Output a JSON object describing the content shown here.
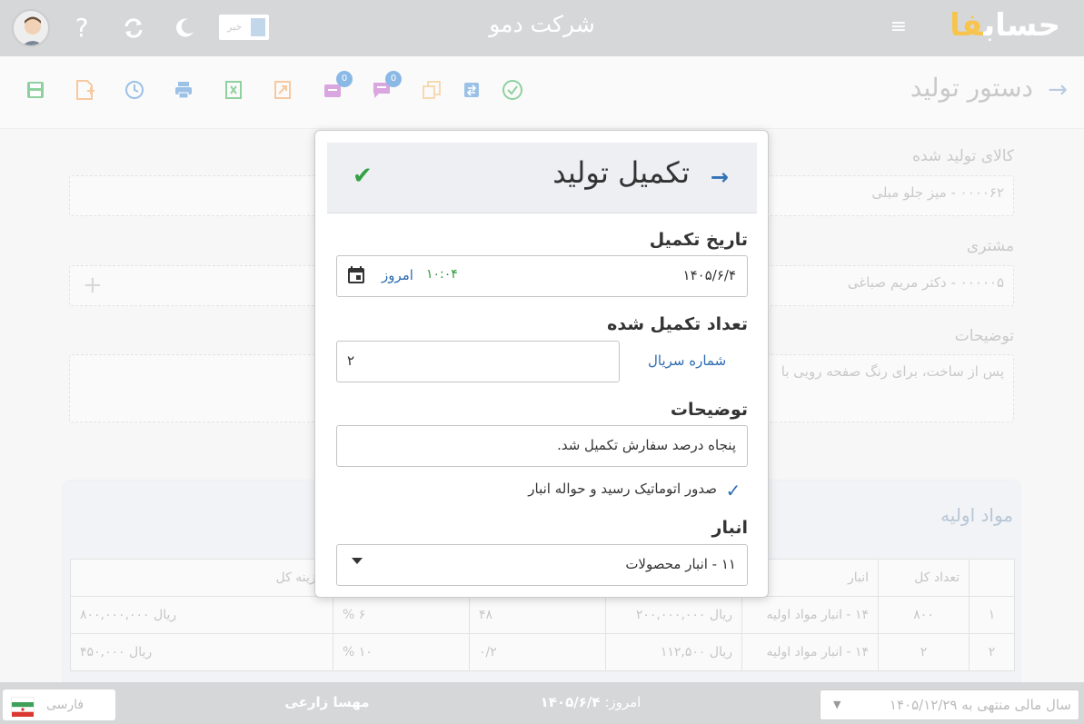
{
  "header": {
    "company_name": "شرکت دمو",
    "logo_main": "حساب",
    "logo_accent": "فا",
    "news_label": "خبر",
    "icons": [
      "avatar",
      "help-icon",
      "refresh-icon",
      "moon-icon",
      "menu-icon"
    ]
  },
  "toolbar": {
    "page_title": "دستور تولید",
    "buttons": [
      "save-icon",
      "add-file-icon",
      "history-icon",
      "print-icon",
      "excel-icon",
      "export-icon",
      "inbox-icon",
      "chat-icon",
      "copy-icon",
      "convert-icon",
      "approve-icon"
    ],
    "badge": "0",
    "colors": {
      "green": "#8fd19e",
      "orange": "#f6c9a0",
      "blue": "#9cc1e6",
      "gray": "#b0bcc9"
    }
  },
  "background_form": {
    "product_label": "کالای تولید شده",
    "product_value": "۰۰۰۰۶۲ - میز جلو مبلی",
    "customer_label": "مشتری",
    "customer_value": "۰۰۰۰۰۵ - دکتر مریم صباغی",
    "notes_label": "توضیحات",
    "notes_value": "پس از ساخت، برای رنگ صفحه رویی با",
    "add_symbol": "+"
  },
  "materials": {
    "title": "مواد اولیه",
    "columns": [
      "",
      "تعداد کل",
      "انبار",
      "",
      "",
      "",
      "هزینه کل"
    ],
    "rows": [
      [
        "۱",
        "۸۰۰",
        "۱۴ - انبار مواد اولیه",
        "ریال ۲۰۰,۰۰۰,۰۰۰",
        "۴۸",
        "۶ %",
        "ریال ۸۰۰,۰۰۰,۰۰۰"
      ],
      [
        "۲",
        "۲",
        "۱۴ - انبار مواد اولیه",
        "ریال ۱۱۲,۵۰۰",
        "۰/۲",
        "۱۰ %",
        "ریال ۴۵۰,۰۰۰"
      ]
    ]
  },
  "dialog": {
    "title": "تکمیل تولید",
    "date_label": "تاریخ تکمیل",
    "date_value": "۱۴۰۵/۶/۴",
    "time_value": "۱۰:۰۴",
    "today_button": "امروز",
    "qty_label": "تعداد تکمیل شده",
    "serial_link": "شماره سریال",
    "qty_value": "۲",
    "notes_label": "توضیحات",
    "notes_value": "پنجاه درصد سفارش تکمیل شد.",
    "auto_issue_label": "صدور اتوماتیک رسید و حواله انبار",
    "auto_issue_checked": true,
    "warehouse_label": "انبار",
    "warehouse_value": "۱۱ - انبار محصولات"
  },
  "statusbar": {
    "fiscal_year": "سال مالی منتهی به ۱۴۰۵/۱۲/۲۹",
    "today_label": "امروز:",
    "today_value": "۱۴۰۵/۶/۴",
    "user_name": "مهسا زارعی",
    "language": "فارسی"
  }
}
